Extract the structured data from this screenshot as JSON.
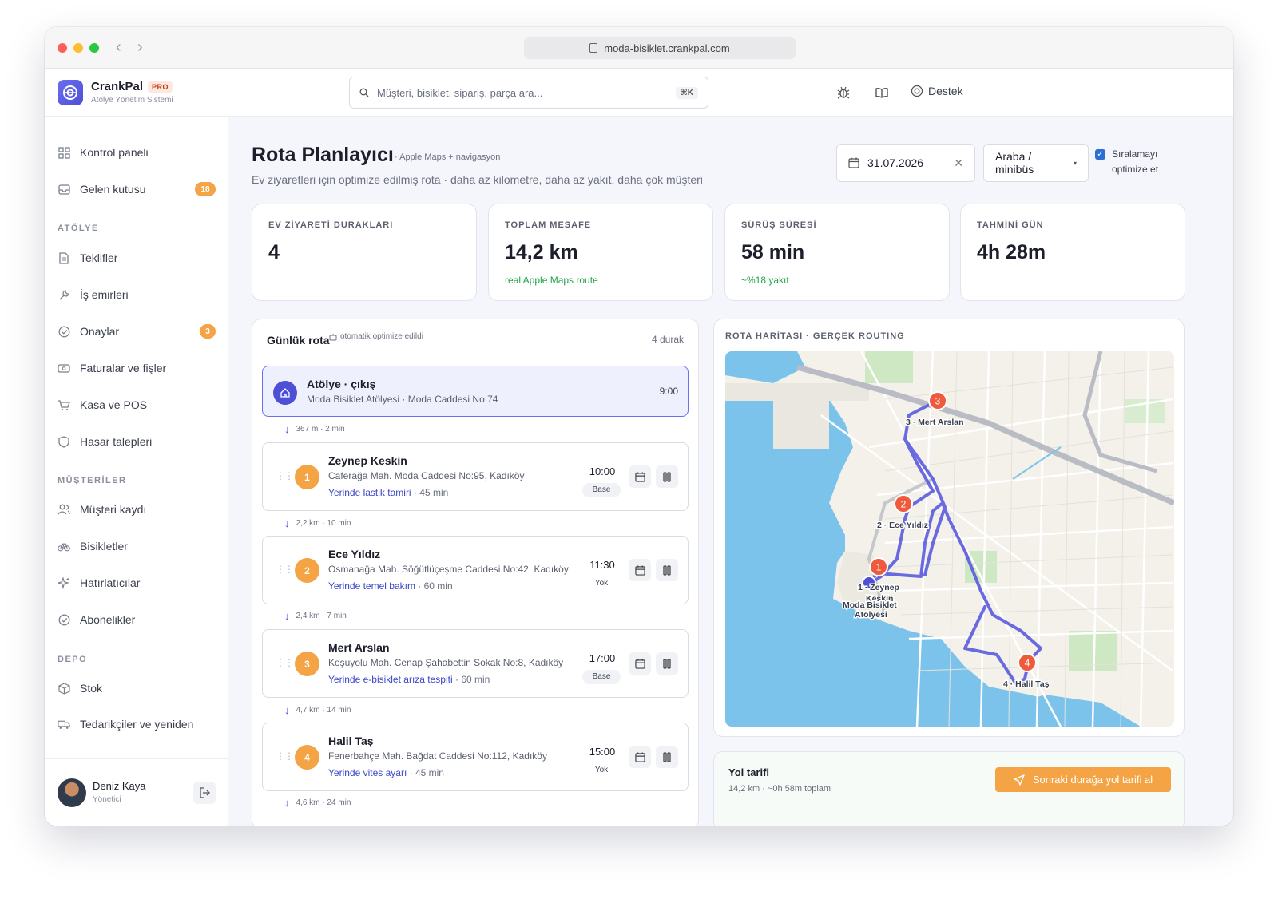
{
  "browser": {
    "url": "moda-bisiklet.crankpal.com"
  },
  "app": {
    "name": "CrankPal",
    "plan": "PRO",
    "subtitle": "Atölye Yönetim Sistemi"
  },
  "header": {
    "search_placeholder": "Müşteri, bisiklet, sipariş, parça ara...",
    "search_shortcut": "⌘K",
    "support_label": "Destek"
  },
  "sidebar": {
    "items_top": [
      {
        "label": "Kontrol paneli",
        "icon": "grid-icon"
      },
      {
        "label": "Gelen kutusu",
        "icon": "inbox-icon",
        "badge": "18"
      }
    ],
    "section_atolye": "ATÖLYE",
    "items_atolye": [
      {
        "label": "Teklifler",
        "icon": "document-icon"
      },
      {
        "label": "İş emirleri",
        "icon": "wrench-icon"
      },
      {
        "label": "Onaylar",
        "icon": "check-circle-icon",
        "badge": "3"
      },
      {
        "label": "Faturalar ve fişler",
        "icon": "receipt-icon"
      },
      {
        "label": "Kasa ve POS",
        "icon": "cart-icon"
      },
      {
        "label": "Hasar talepleri",
        "icon": "shield-icon"
      }
    ],
    "section_musteriler": "MÜŞTERİLER",
    "items_musteriler": [
      {
        "label": "Müşteri kaydı",
        "icon": "users-icon"
      },
      {
        "label": "Bisikletler",
        "icon": "bike-icon"
      },
      {
        "label": "Hatırlatıcılar",
        "icon": "sparkle-icon"
      },
      {
        "label": "Abonelikler",
        "icon": "check-circle-icon"
      }
    ],
    "section_depo": "DEPO",
    "items_depo": [
      {
        "label": "Stok",
        "icon": "box-icon"
      },
      {
        "label": "Tedarikçiler ve yeniden",
        "icon": "truck-icon"
      }
    ],
    "user": {
      "name": "Deniz Kaya",
      "role": "Yönetici"
    }
  },
  "page": {
    "title": "Rota Planlayıcı",
    "tag": "· Apple Maps + navigasyon",
    "subtitle": "Ev ziyaretleri için optimize edilmiş rota · daha az kilometre, daha az yakıt, daha çok müşteri",
    "date": "31.07.2026",
    "vehicle": "Araba / minibüs",
    "optimize_label_1": "Sıralamayı",
    "optimize_label_2": "optimize et",
    "optimize_checked": true
  },
  "stats": [
    {
      "label": "EV ZİYARETİ DURAKLARI",
      "value": "4",
      "note": ""
    },
    {
      "label": "TOPLAM MESAFE",
      "value": "14,2 km",
      "note": "real Apple Maps route"
    },
    {
      "label": "SÜRÜŞ SÜRESİ",
      "value": "58 min",
      "note": "~%18 yakıt"
    },
    {
      "label": "TAHMİNİ GÜN",
      "value": "4h 28m",
      "note": ""
    }
  ],
  "route": {
    "title": "Günlük rota",
    "auto_note": "otomatik optimize edildi",
    "count": "4 durak",
    "origin": {
      "title": "Atölye · çıkış",
      "address": "Moda Bisiklet Atölyesi · Moda Caddesi No:74",
      "time": "9:00"
    },
    "legs": [
      "367 m · 2 min",
      "2,2 km · 10 min",
      "2,4 km · 7 min",
      "4,7 km · 14 min",
      "4,6 km · 24 min"
    ],
    "stops": [
      {
        "num": "1",
        "name": "Zeynep Keskin",
        "address": "Caferağa Mah. Moda Caddesi No:95, Kadıköy",
        "service": "Yerinde lastik tamiri",
        "duration": "· 45 min",
        "time": "10:00",
        "tag": "Base"
      },
      {
        "num": "2",
        "name": "Ece Yıldız",
        "address": "Osmanağa Mah. Söğütlüçeşme Caddesi No:42, Kadıköy",
        "service": "Yerinde temel bakım",
        "duration": "· 60 min",
        "time": "11:30",
        "tag": "Yok"
      },
      {
        "num": "3",
        "name": "Mert Arslan",
        "address": "Koşuyolu Mah. Cenap Şahabettin Sokak No:8, Kadıköy",
        "service": "Yerinde e-bisiklet arıza tespiti",
        "duration": "· 60 min",
        "time": "17:00",
        "tag": "Base"
      },
      {
        "num": "4",
        "name": "Halil Taş",
        "address": "Fenerbahçe Mah. Bağdat Caddesi No:112, Kadıköy",
        "service": "Yerinde vites ayarı",
        "duration": "· 45 min",
        "time": "15:00",
        "tag": "Yok"
      }
    ]
  },
  "map": {
    "title": "ROTA HARİTASI · GERÇEK ROUTING",
    "labels": {
      "m3": "3 · Mert Arslan",
      "m2": "2 · Ece Yıldız",
      "m1a": "1 · Zeynep",
      "m1b": "Keskin",
      "originA": "Moda Bisiklet",
      "originB": "Atölyesi",
      "m4": "4 · Halil Taş"
    },
    "marker_numbers": [
      "1",
      "2",
      "3",
      "4"
    ]
  },
  "directions": {
    "title": "Yol tarifi",
    "subtitle": "14,2 km · ~0h 58m toplam",
    "button": "Sonraki durağa yol tarifi al"
  },
  "colors": {
    "accent": "#4d4fd6",
    "orange": "#f4a444",
    "marker": "#ef5a3c",
    "route": "#5b5ce0",
    "water": "#7cc3ec"
  }
}
